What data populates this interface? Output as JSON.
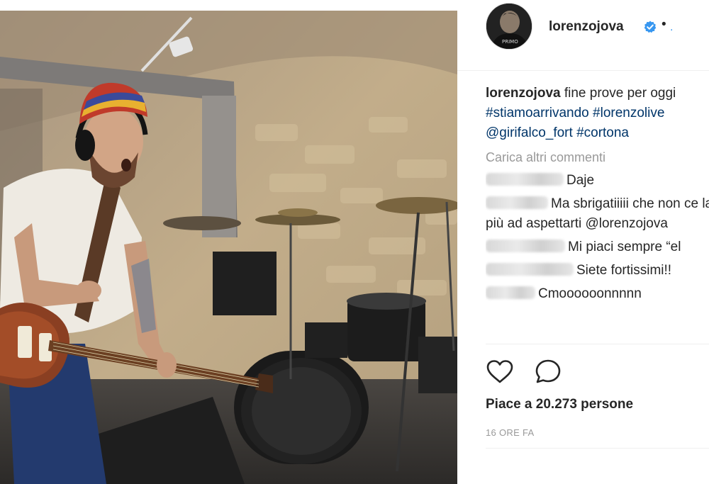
{
  "post": {
    "username": "lorenzojova",
    "verified": true,
    "separator": "•",
    "follow_label": ".",
    "avatar_text": "PRIMO",
    "caption": {
      "username": "lorenzojova",
      "text": "fine prove per oggi",
      "hashtags_line1": [
        "#stiamoarrivando",
        "#lorenzolive"
      ],
      "mention": "@girifalco_fort",
      "hashtag_line2": "#cortona"
    },
    "load_more": "Carica altri commenti",
    "comments": [
      {
        "user": "alfonsolan19",
        "text": "Daje"
      },
      {
        "user": "alfina_3.8",
        "text": "Ma sbrigatiiiii che non ce la faccio",
        "text2": "più ad aspettarti @lorenzojova"
      },
      {
        "user": "laurat1105",
        "text": "Mi piaci sempre “el"
      },
      {
        "user": "oliviamatt77",
        "text": "Siete fortissimi!!"
      },
      {
        "user": "lazizzi9",
        "text": "Cmoooooonnnnn"
      }
    ],
    "likes": "Piace a 20.273 persone",
    "timestamp": "16 ORE FA",
    "icons": [
      "heart-icon",
      "comment-icon"
    ]
  }
}
